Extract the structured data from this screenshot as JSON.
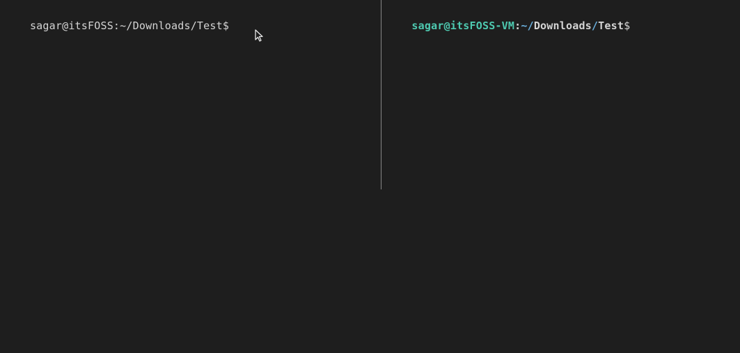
{
  "left_pane": {
    "prompt": "sagar@itsFOSS:~/Downloads/Test$",
    "command": ""
  },
  "right_pane": {
    "user_host": "sagar@itsFOSS-VM",
    "colon": ":",
    "tilde_slash": "~/",
    "seg1": "Downloads",
    "slash": "/",
    "seg2": "Test",
    "dollar": "$",
    "command": ""
  }
}
